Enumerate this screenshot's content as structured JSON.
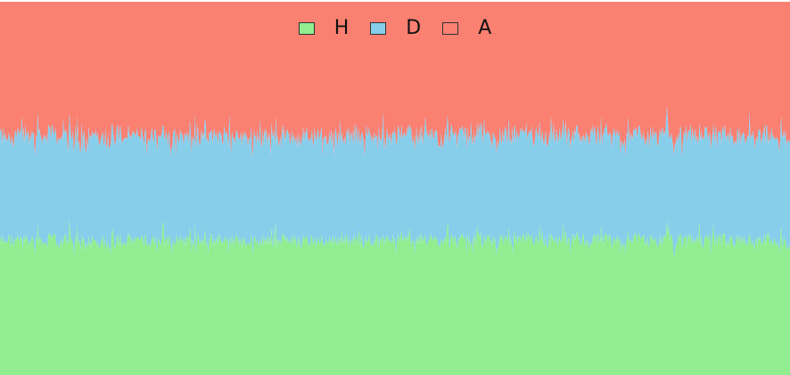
{
  "chart_data": {
    "type": "area",
    "stacked": true,
    "normalized": true,
    "legend": {
      "placement": "top-center",
      "entries": [
        {
          "label": "H",
          "color": "#90ee90"
        },
        {
          "label": "D",
          "color": "#87ceeb"
        },
        {
          "label": "A",
          "color": "#fa8072"
        }
      ]
    },
    "ylim": [
      0,
      1
    ],
    "grid": false,
    "n_points": 900,
    "series": [
      {
        "name": "H",
        "color": "#90ee90",
        "mean_share": 0.36,
        "share_range": [
          0.32,
          0.49
        ]
      },
      {
        "name": "D",
        "color": "#87ceeb",
        "mean_share": 0.28,
        "share_range": [
          0.22,
          0.35
        ]
      },
      {
        "name": "A",
        "color": "#fa8072",
        "mean_share": 0.36,
        "share_range": [
          0.28,
          0.44
        ]
      }
    ]
  }
}
